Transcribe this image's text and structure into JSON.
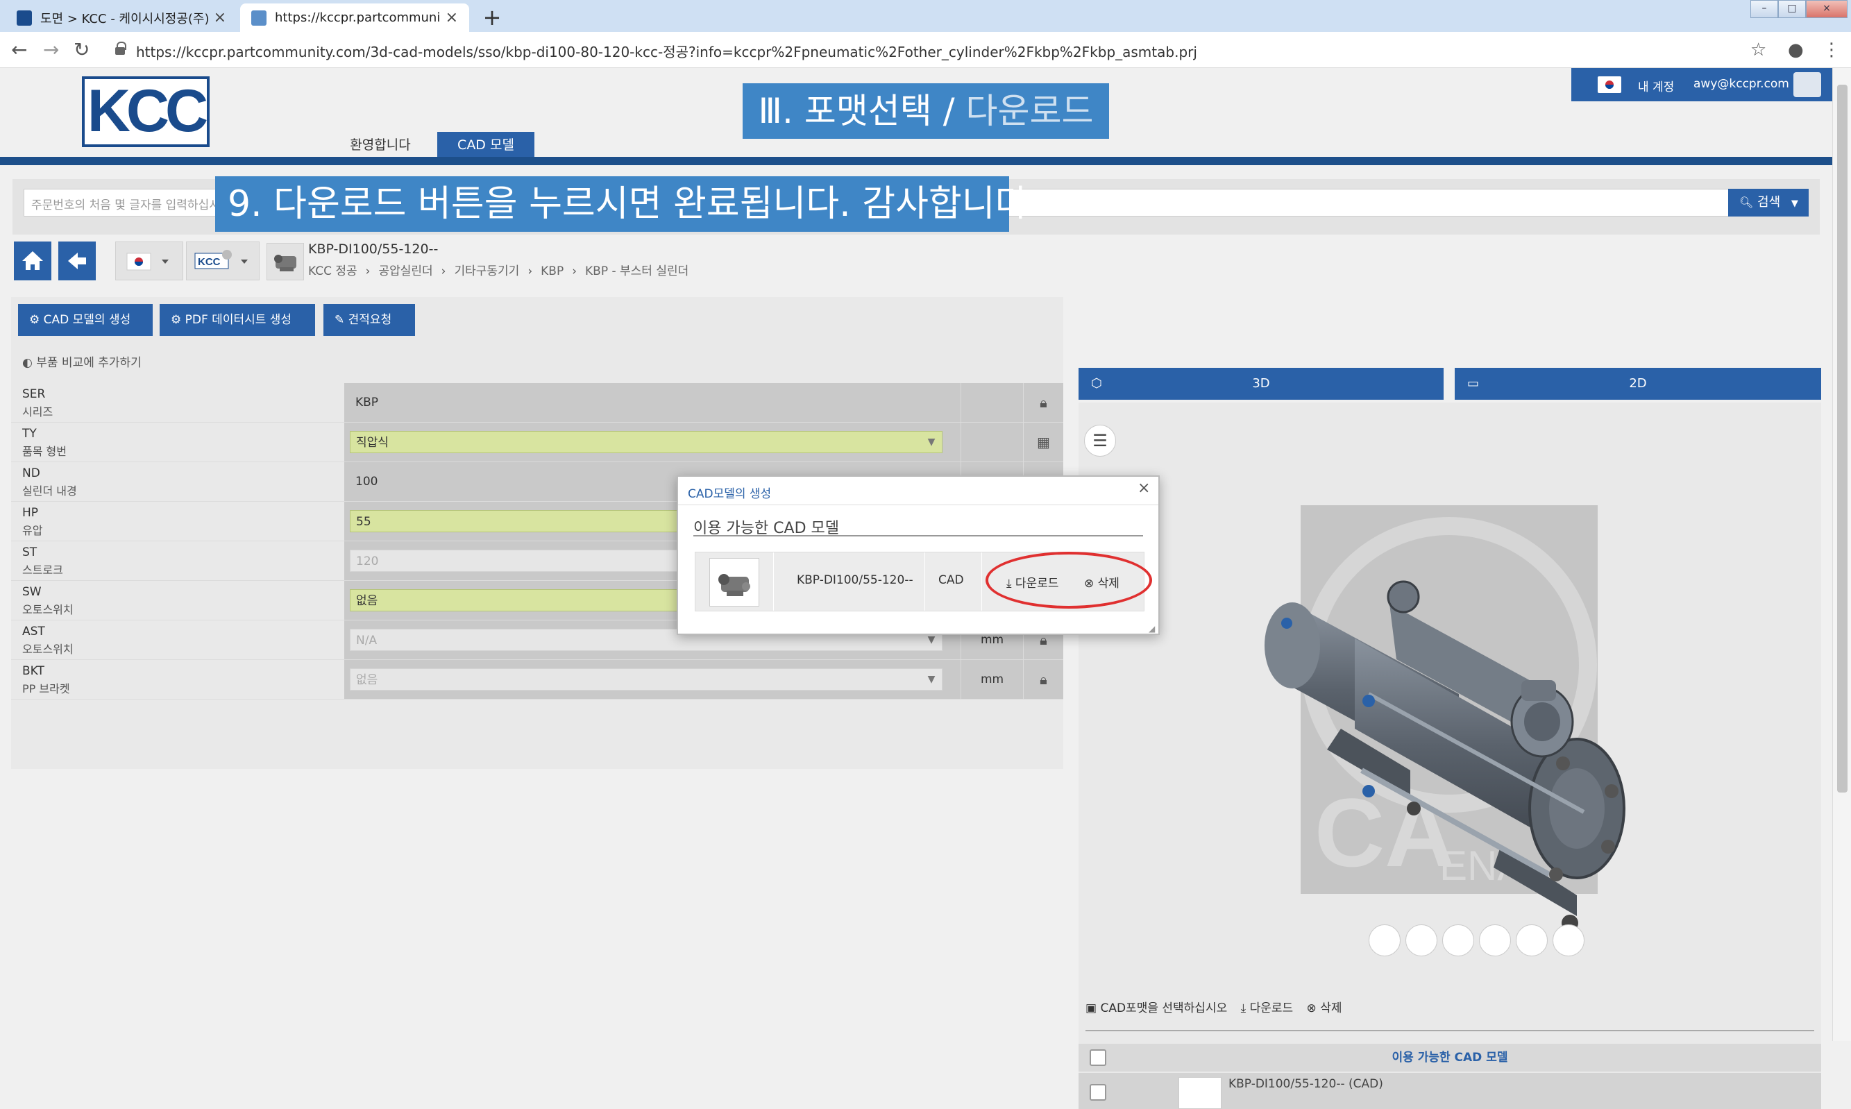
{
  "browser": {
    "tabs": [
      {
        "title": "도면 > KCC - 케이시시정공(주)",
        "active": false
      },
      {
        "title": "https://kccpr.partcommunity.con",
        "active": true
      }
    ],
    "new_tab": "+",
    "url": "https://kccpr.partcommunity.com/3d-cad-models/sso/kbp-di100-80-120-kcc-정공?info=kccpr%2Fpneumatic%2Fother_cylinder%2Fkbp%2Fkbp_asmtab.prj"
  },
  "header": {
    "logo_text": "KCC",
    "nav": [
      "환영합니다",
      "CAD 모델"
    ],
    "account_label": "내 계정",
    "email": "awy@kccpr.com"
  },
  "banners": {
    "title_left": "Ⅲ. 포맷선택 / ",
    "title_right": "다운로드",
    "step": "9. 다운로드 버튼을 누르시면 완료됩니다. 감사합니다."
  },
  "search": {
    "placeholder": "주문번호의 처음 몇 글자를 입력하십시오",
    "button": "검색"
  },
  "part": {
    "name": "KBP-DI100/55-120--",
    "breadcrumb": [
      "KCC 정공",
      "공압실린더",
      "기타구동기기",
      "KBP",
      "KBP - 부스터 실린더"
    ]
  },
  "actions": {
    "cad_gen": "CAD 모델의 생성",
    "pdf": "PDF 데이터시트 생성",
    "quote": "견적요청",
    "compare": "부품 비교에 추가하기"
  },
  "params": [
    {
      "code": "SER",
      "desc": "시리즈",
      "value": "KBP",
      "style": "plain",
      "unit": "",
      "icon": "lock"
    },
    {
      "code": "TY",
      "desc": "품목 형번",
      "value": "직압식",
      "style": "yellow",
      "unit": "",
      "icon": "table"
    },
    {
      "code": "ND",
      "desc": "실린더 내경",
      "value": "100",
      "style": "plain",
      "unit": "",
      "icon": ""
    },
    {
      "code": "HP",
      "desc": "유압",
      "value": "55",
      "style": "yellow",
      "unit": "",
      "icon": ""
    },
    {
      "code": "ST",
      "desc": "스트로크",
      "value": "120",
      "style": "disabled",
      "unit": "",
      "icon": ""
    },
    {
      "code": "SW",
      "desc": "오토스위치",
      "value": "없음",
      "style": "yellow",
      "unit": "",
      "icon": ""
    },
    {
      "code": "AST",
      "desc": "오토스위치",
      "value": "N/A",
      "style": "disabled",
      "unit": "mm",
      "icon": "lock"
    },
    {
      "code": "BKT",
      "desc": "PP 브라켓",
      "value": "없음",
      "style": "disabled",
      "unit": "mm",
      "icon": "lock"
    }
  ],
  "viewer": {
    "tab_3d": "3D",
    "tab_2d": "2D",
    "watermark_text": "CA",
    "watermark_sub": "ENA"
  },
  "cad_panel": {
    "select_format": "CAD포맷을 선택하십시오",
    "download": "다운로드",
    "delete": "삭제",
    "header": "이용 가능한 CAD 모델",
    "row_name": "KBP-DI100/55-120-- (CAD)"
  },
  "dialog": {
    "title": "CAD모델의 생성",
    "subtitle": "이용 가능한 CAD 모델",
    "model_name": "KBP-DI100/55-120--",
    "model_type": "CAD",
    "download": "다운로드",
    "delete": "삭제"
  },
  "colors": {
    "primary": "#2a61a8",
    "header_bar": "#1d4f8a",
    "banner": "#3f86c6",
    "highlight": "#e03030",
    "yellow_field": "#d8e4a0"
  }
}
